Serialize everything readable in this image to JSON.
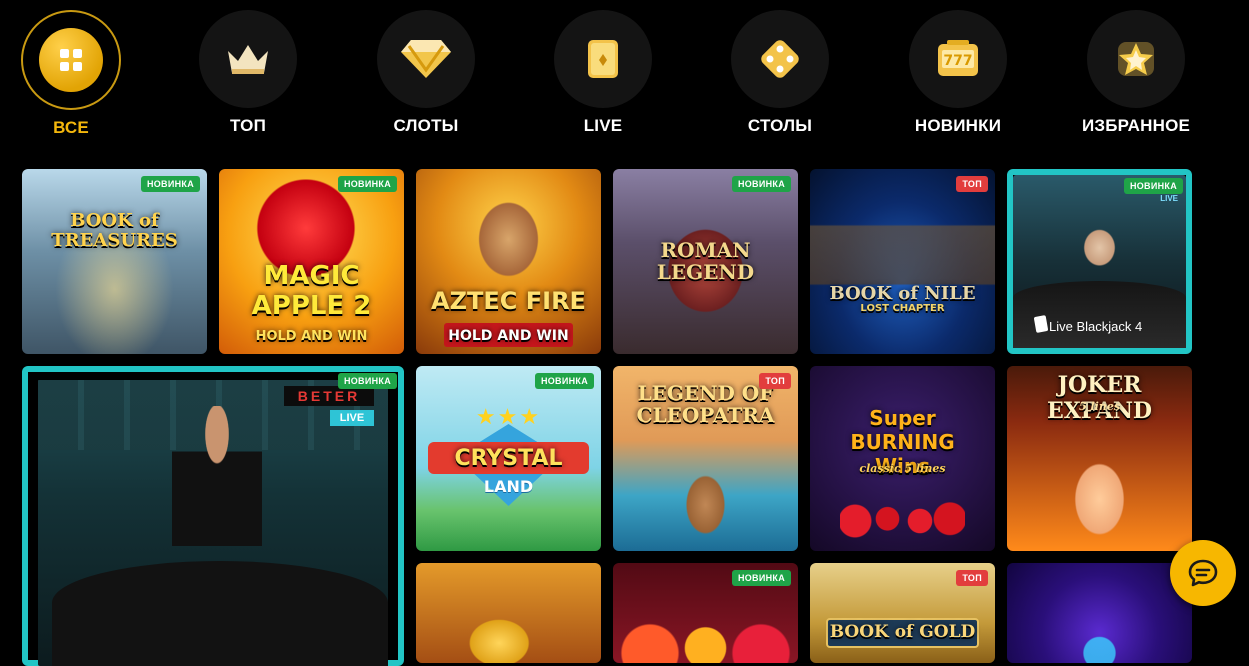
{
  "categories": [
    {
      "label": "ВСЕ",
      "icon": "grid-icon",
      "active": true
    },
    {
      "label": "ТОП",
      "icon": "crown-icon"
    },
    {
      "label": "СЛОТЫ",
      "icon": "diamond-icon"
    },
    {
      "label": "LIVE",
      "icon": "card-icon"
    },
    {
      "label": "СТОЛЫ",
      "icon": "dice-icon"
    },
    {
      "label": "НОВИНКИ",
      "icon": "slot-777-icon"
    },
    {
      "label": "ИЗБРАННОЕ",
      "icon": "star-icon"
    }
  ],
  "games": [
    {
      "title": "BOOK of TREASURES",
      "badge": "НОВИНКА"
    },
    {
      "title": "MAGIC APPLE 2",
      "subtitle": "HOLD AND WIN",
      "badge": "НОВИНКА"
    },
    {
      "title": "AZTEC FIRE",
      "subtitle": "HOLD AND WIN"
    },
    {
      "title": "ROMAN LEGEND",
      "badge": "НОВИНКА"
    },
    {
      "title": "BOOK of NILE",
      "subtitle": "LOST CHAPTER",
      "badge": "ТОП"
    },
    {
      "caption": "Live Blackjack 4",
      "badge": "НОВИНКА",
      "corner": "LIVE"
    },
    {
      "brand": "BETER",
      "live": "LIVE",
      "badge": "НОВИНКА"
    },
    {
      "title": "CRYSTAL",
      "subtitle": "LAND",
      "badge": "НОВИНКА"
    },
    {
      "title": "LEGEND OF CLEOPATRA",
      "badge": "ТОП"
    },
    {
      "title": "Super BURNING Wins",
      "subtitle": "classic 5 lines"
    },
    {
      "title": "JOKER EXPAND",
      "subtitle": "5 lines"
    },
    {
      "title": ""
    },
    {
      "badge": "НОВИНКА"
    },
    {
      "title": "BOOK of GOLD",
      "badge": "ТОП"
    },
    {
      "title": ""
    }
  ],
  "chat": {
    "icon": "chat-icon"
  }
}
